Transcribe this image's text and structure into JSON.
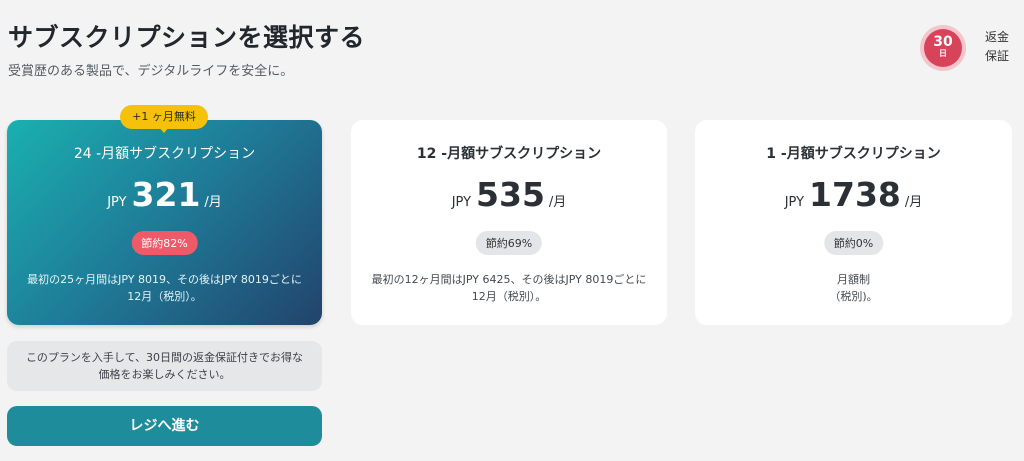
{
  "header": {
    "title": "サブスクリプションを選択する",
    "subtitle": "受賞歴のある製品で、デジタルライフを安全に。"
  },
  "guarantee": {
    "badge_number": "30",
    "badge_unit": "日",
    "label": "返金保証",
    "badge_color": "#d9435a"
  },
  "plans": [
    {
      "promo": "+1 ヶ月無料",
      "name": "24 -月額サブスクリプション",
      "currency": "JPY",
      "price": "321",
      "per": "/月",
      "savings": "節約82%",
      "note": "最初の25ヶ月間はJPY 8019、その後はJPY 8019ごとに12月（税別）。",
      "selected": true
    },
    {
      "name": "12 -月額サブスクリプション",
      "currency": "JPY",
      "price": "535",
      "per": "/月",
      "savings": "節約69%",
      "note": "最初の12ヶ月間はJPY 6425、その後はJPY 8019ごとに12月（税別）。",
      "selected": false
    },
    {
      "name": "1 -月額サブスクリプション",
      "currency": "JPY",
      "price": "1738",
      "per": "/月",
      "savings": "節約0%",
      "note": "月額制\n（税別)。",
      "selected": false
    }
  ],
  "info_text": "このプランを入手して、30日間の返金保証付きでお得な価格をお楽しみください。",
  "checkout_button": "レジへ進む",
  "colors": {
    "accent": "#1f8c9b",
    "promo": "#f5c10a",
    "savings_highlight": "#ee5a68"
  }
}
